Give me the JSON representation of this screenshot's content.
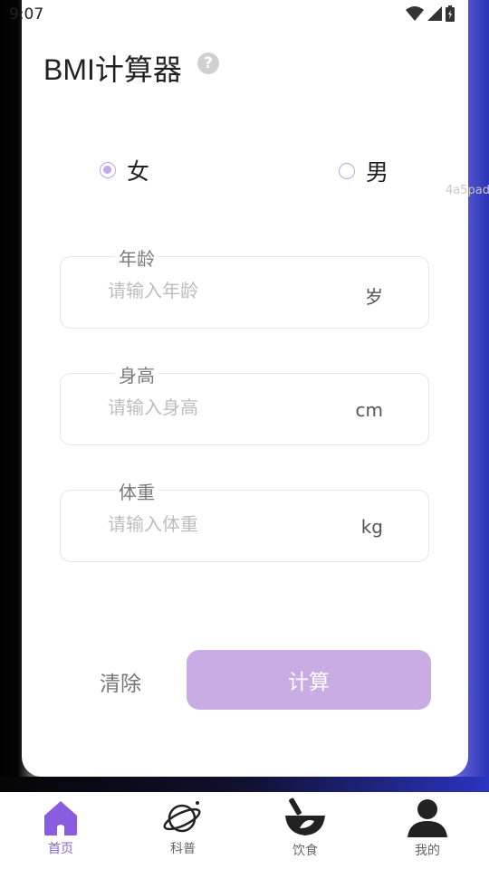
{
  "status": {
    "time": "9:07"
  },
  "header": {
    "title": "BMI计算器"
  },
  "watermark": "4a5pad",
  "gender": {
    "female": {
      "label": "女",
      "checked": true
    },
    "male": {
      "label": "男",
      "checked": false
    }
  },
  "fields": {
    "age": {
      "label": "年龄",
      "placeholder": "请输入年龄",
      "unit": "岁"
    },
    "height": {
      "label": "身高",
      "placeholder": "请输入身高",
      "unit": "cm"
    },
    "weight": {
      "label": "体重",
      "placeholder": "请输入体重",
      "unit": "kg"
    }
  },
  "actions": {
    "clear_label": "清除",
    "calculate_label": "计算"
  },
  "tabs": [
    {
      "label": "首页",
      "icon": "home-icon",
      "active": true
    },
    {
      "label": "科普",
      "icon": "planet-icon",
      "active": false
    },
    {
      "label": "饮食",
      "icon": "mortar-bowl-icon",
      "active": false
    },
    {
      "label": "我的",
      "icon": "user-icon",
      "active": false
    }
  ],
  "colors": {
    "accent": "#8a63d2",
    "button": "#c9ace3",
    "radio": "#c3a9e8"
  }
}
